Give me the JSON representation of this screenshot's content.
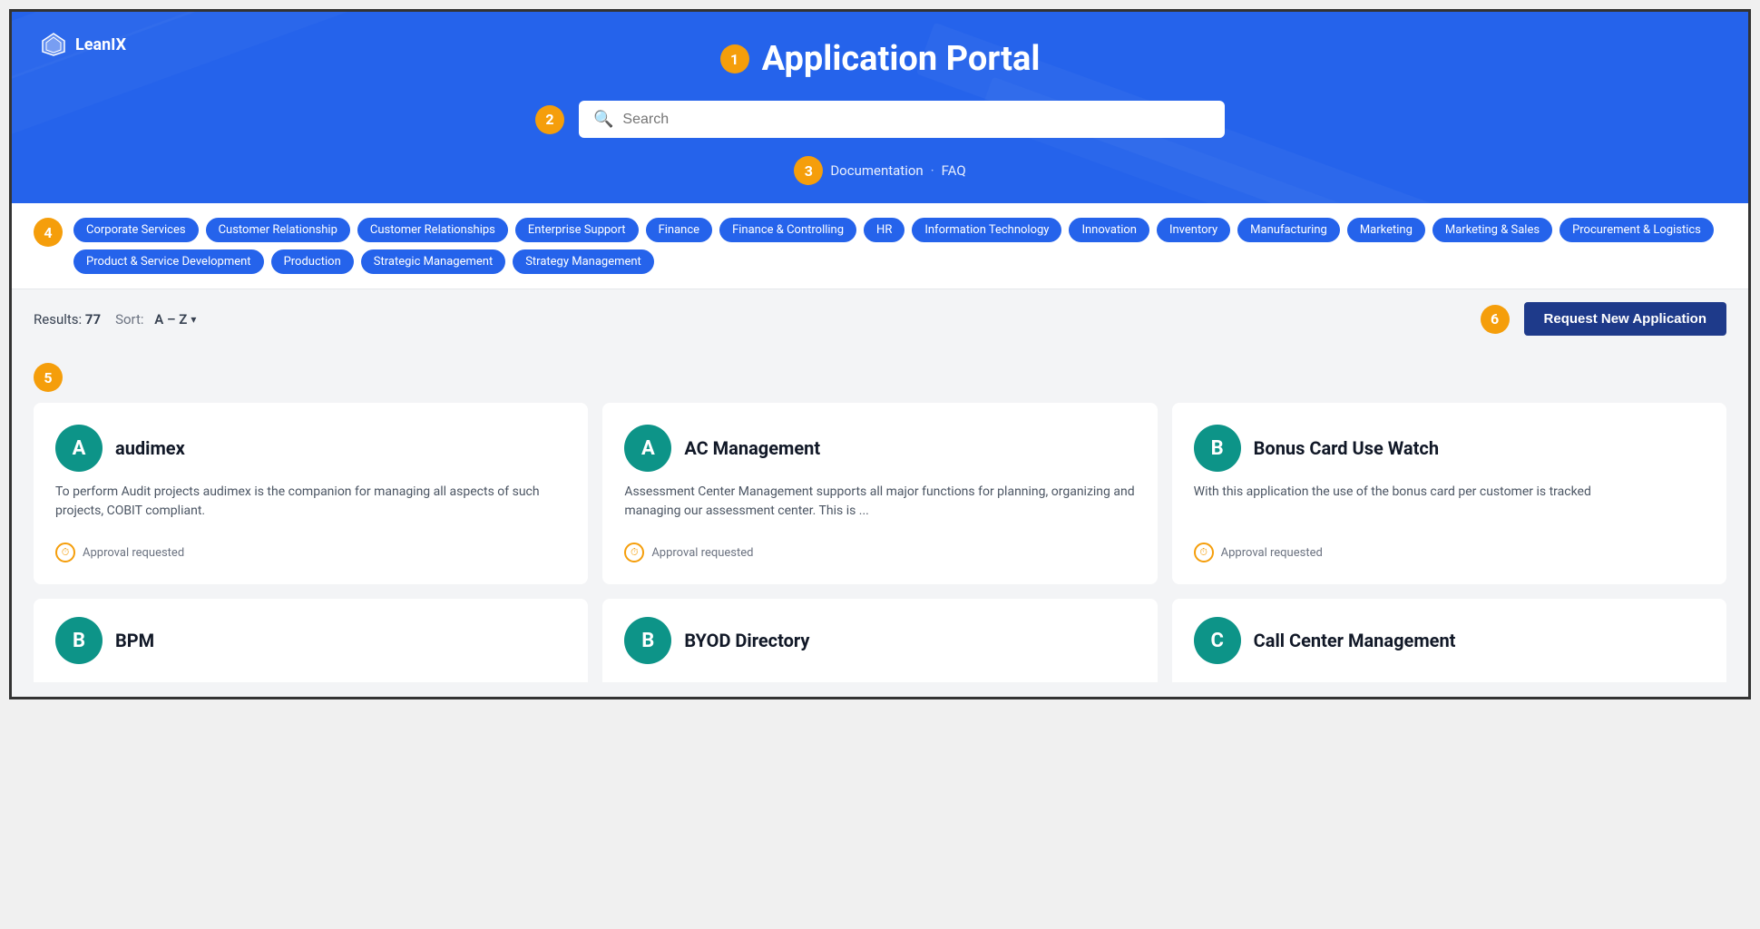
{
  "logo": {
    "name": "LeanIX"
  },
  "header": {
    "badge_number": "1",
    "title": "Application Portal",
    "search_placeholder": "Search",
    "search_badge": "2",
    "nav_badge": "3",
    "nav_items": [
      {
        "label": "Documentation",
        "id": "documentation"
      },
      {
        "separator": "·"
      },
      {
        "label": "FAQ",
        "id": "faq"
      }
    ]
  },
  "filters": {
    "badge_number": "4",
    "tags": [
      "Corporate Services",
      "Customer Relationship",
      "Customer Relationships",
      "Enterprise Support",
      "Finance",
      "Finance & Controlling",
      "HR",
      "Information Technology",
      "Innovation",
      "Inventory",
      "Manufacturing",
      "Marketing",
      "Marketing & Sales",
      "Procurement & Logistics",
      "Product & Service Development",
      "Production",
      "Strategic Management",
      "Strategy Management"
    ]
  },
  "results": {
    "label": "Results:",
    "count": "77",
    "sort_label": "Sort:",
    "sort_value": "A – Z",
    "request_button": "Request New Application",
    "request_badge": "6"
  },
  "cards_badge": "5",
  "apps": [
    {
      "letter": "A",
      "name": "audimex",
      "description": "To perform Audit projects audimex is the companion for managing all aspects of such projects, COBIT compliant.",
      "status": "Approval requested"
    },
    {
      "letter": "A",
      "name": "AC Management",
      "description": "Assessment Center Management supports all major functions for planning, organizing and managing our assessment center. This is ...",
      "status": "Approval requested"
    },
    {
      "letter": "B",
      "name": "Bonus Card Use Watch",
      "description": "With this application the use of the bonus card per customer is tracked",
      "status": "Approval requested"
    }
  ],
  "partial_apps": [
    {
      "letter": "B",
      "name": "BPM"
    },
    {
      "letter": "B",
      "name": "BYOD Directory"
    },
    {
      "letter": "C",
      "name": "Call Center Management"
    }
  ]
}
